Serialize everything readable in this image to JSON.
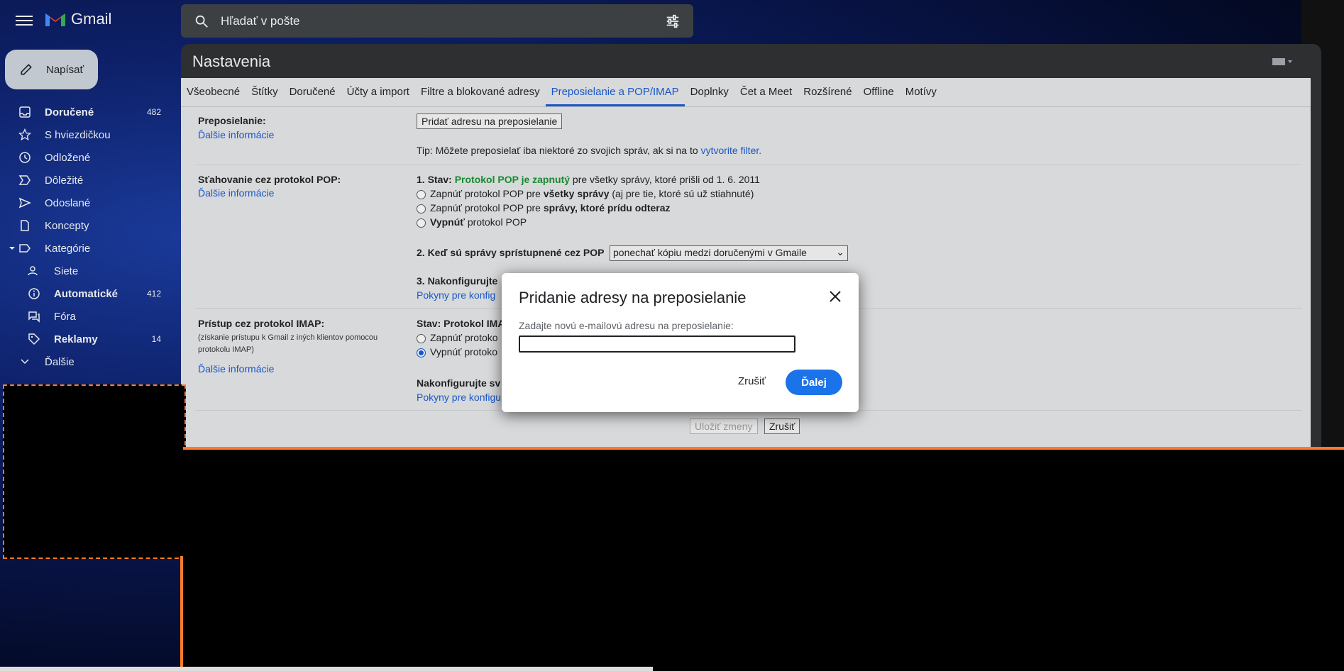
{
  "header": {
    "app_name": "Gmail",
    "search_placeholder": "Hľadať v pošte"
  },
  "compose_label": "Napísať",
  "nav": [
    {
      "label": "Doručené",
      "count": "482",
      "bold": true,
      "icon": "inbox-icon"
    },
    {
      "label": "S hviezdičkou",
      "count": "",
      "icon": "star-icon"
    },
    {
      "label": "Odložené",
      "count": "",
      "icon": "clock-icon"
    },
    {
      "label": "Dôležité",
      "count": "",
      "icon": "important-icon"
    },
    {
      "label": "Odoslané",
      "count": "",
      "icon": "send-icon"
    },
    {
      "label": "Koncepty",
      "count": "",
      "icon": "draft-icon"
    },
    {
      "label": "Kategórie",
      "count": "",
      "icon": "label-icon"
    },
    {
      "label": "Siete",
      "count": "",
      "icon": "people-icon"
    },
    {
      "label": "Automatické",
      "count": "412",
      "bold": true,
      "icon": "info-icon"
    },
    {
      "label": "Fóra",
      "count": "",
      "icon": "forum-icon"
    },
    {
      "label": "Reklamy",
      "count": "14",
      "bold": true,
      "icon": "tag-icon"
    },
    {
      "label": "Ďalšie",
      "count": "",
      "icon": "chevron-down-icon"
    }
  ],
  "settings": {
    "title": "Nastavenia",
    "tabs": [
      "Všeobecné",
      "Štítky",
      "Doručené",
      "Účty a import",
      "Filtre a blokované adresy",
      "Preposielanie a POP/IMAP",
      "Doplnky",
      "Čet a Meet",
      "Rozšírené",
      "Offline",
      "Motívy"
    ],
    "active_tab": "Preposielanie a POP/IMAP",
    "more_info": "Ďalšie informácie",
    "forwarding": {
      "label": "Preposielanie:",
      "add_button": "Pridať adresu na preposielanie",
      "tip_prefix": "Tip: Môžete preposielať iba niektoré zo svojich správ, ak si na to ",
      "tip_link": "vytvorite filter."
    },
    "pop": {
      "label": "Sťahovanie cez protokol POP:",
      "status_prefix": "1. Stav: ",
      "status_value": "Protokol POP je zapnutý",
      "status_suffix": " pre všetky správy, ktoré prišli od 1. 6. 2011",
      "opt1_a": "Zapnúť protokol POP pre ",
      "opt1_b": "všetky správy",
      "opt1_c": " (aj pre tie, ktoré sú už stiahnuté)",
      "opt2_a": "Zapnúť protokol POP pre ",
      "opt2_b": "správy, ktoré prídu odteraz",
      "opt3_a": "Vypnúť",
      "opt3_b": " protokol POP",
      "q2": "2. Keď sú správy sprístupnené cez POP",
      "q2_select": "ponechať kópiu medzi doručenými v Gmaile",
      "q3": "3. Nakonfigurujte",
      "q3_link": "Pokyny pre konfig"
    },
    "imap": {
      "label": "Prístup cez protokol IMAP:",
      "note": "(získanie prístupu k Gmail z iných klientov pomocou protokolu IMAP)",
      "status": "Stav: Protokol IMA",
      "opt1": "Zapnúť protoko",
      "opt2": "Vypnúť protoko",
      "config": "Nakonfigurujte sv",
      "config_link": "Pokyny pre konfigu"
    },
    "save_button": "Uložiť zmeny",
    "cancel_button": "Zrušiť"
  },
  "dialog": {
    "title": "Pridanie adresy na preposielanie",
    "label": "Zadajte novú e-mailovú adresu na preposielanie:",
    "input_value": "",
    "cancel": "Zrušiť",
    "next": "Ďalej"
  },
  "colors": {
    "accent": "#1a73e8",
    "orange_outline": "#ff7b2a",
    "pop_status": "#198a2e"
  }
}
